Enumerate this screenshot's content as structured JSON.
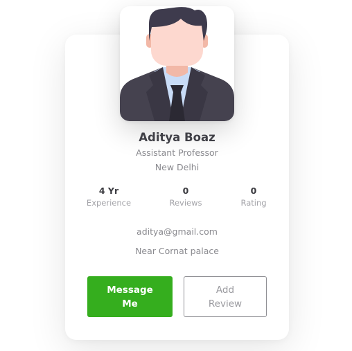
{
  "profile": {
    "name": "Aditya Boaz",
    "title": "Assistant Professor",
    "location": "New Delhi",
    "avatar_icon": "person-avatar-icon"
  },
  "stats": [
    {
      "value": "4 Yr",
      "label": "Experience"
    },
    {
      "value": "0",
      "label": "Reviews"
    },
    {
      "value": "0",
      "label": "Rating"
    }
  ],
  "contact": {
    "email": "aditya@gmail.com",
    "address": "Near Cornat palace"
  },
  "actions": {
    "message_label": "Message Me",
    "review_label": "Add Review"
  },
  "colors": {
    "primary": "#35ae1e",
    "text_dark": "#3f3f46",
    "text_muted": "#8a8a8f"
  }
}
